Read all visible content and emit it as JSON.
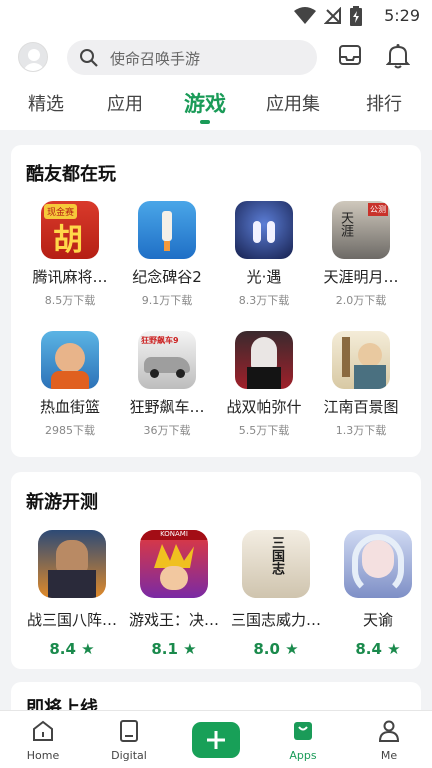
{
  "status_bar": {
    "time": "5:29"
  },
  "search": {
    "placeholder": "使命召唤手游"
  },
  "tabs": [
    {
      "label": "精选"
    },
    {
      "label": "应用"
    },
    {
      "label": "游戏",
      "active": true
    },
    {
      "label": "应用集"
    },
    {
      "label": "排行"
    }
  ],
  "friends_playing": {
    "title": "酷友都在玩",
    "apps": [
      {
        "name": "腾讯麻将…",
        "downloads": "8.5万下载"
      },
      {
        "name": "纪念碑谷2",
        "downloads": "9.1万下载"
      },
      {
        "name": "光·遇",
        "downloads": "8.3万下载"
      },
      {
        "name": "天涯明月…",
        "downloads": "2.0万下载"
      },
      {
        "name": "热血街篮",
        "downloads": "2985下载"
      },
      {
        "name": "狂野飙车…",
        "downloads": "36万下载"
      },
      {
        "name": "战双帕弥什",
        "downloads": "5.5万下载"
      },
      {
        "name": "江南百景图",
        "downloads": "1.3万下载"
      }
    ]
  },
  "new_tests": {
    "title": "新游开测",
    "apps": [
      {
        "name": "战三国八阵…",
        "score": "8.4 ★"
      },
      {
        "name": "游戏王：决…",
        "score": "8.1 ★"
      },
      {
        "name": "三国志威力…",
        "score": "8.0 ★"
      },
      {
        "name": "天谕",
        "score": "8.4 ★"
      }
    ]
  },
  "upcoming": {
    "title": "即将上线"
  },
  "bottom_nav": [
    {
      "label": "Home"
    },
    {
      "label": "Digital"
    },
    {
      "label": ""
    },
    {
      "label": "Apps",
      "active": true
    },
    {
      "label": "Me"
    }
  ],
  "icons": {
    "app1_text": "胡",
    "app1_badge": "现金赛",
    "app4_text": "天涯",
    "app4_badge": "公测",
    "app6_text": "狂野飙车9",
    "app11_text": "三国志",
    "app10_text": "KONAMI"
  },
  "colors": {
    "accent": "#1a9b58",
    "score": "#1a8a4c"
  }
}
